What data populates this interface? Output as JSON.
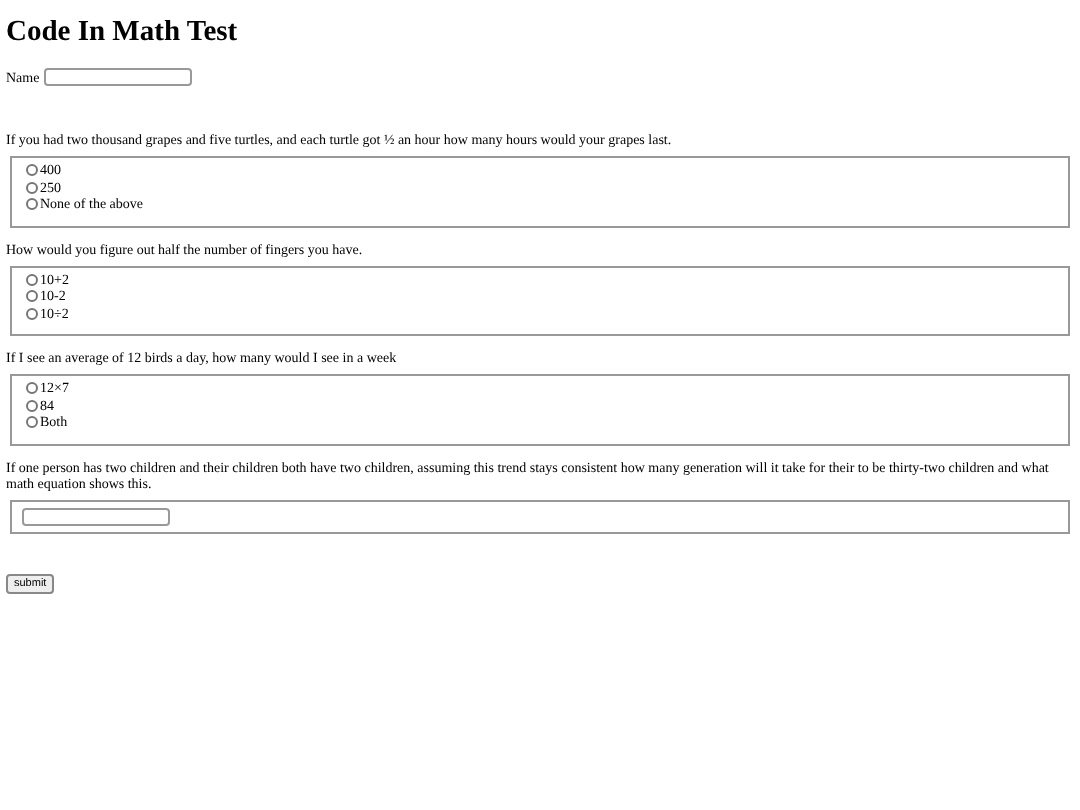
{
  "title": "Code In Math Test",
  "name_field": {
    "label": "Name"
  },
  "questions": [
    {
      "kind": "choice",
      "text": "If you had two thousand grapes and five turtles, and each turtle got ½ an hour how many hours would your grapes last.",
      "options": [
        {
          "label": "400",
          "selected": false
        },
        {
          "label": "250",
          "selected": false
        },
        {
          "label": "None of the above",
          "selected": false
        }
      ]
    },
    {
      "kind": "choice",
      "text": "How would you figure out half the number of fingers you have.",
      "options": [
        {
          "label": "10+2",
          "selected": false
        },
        {
          "label": "10-2",
          "selected": false
        },
        {
          "label": "10÷2",
          "selected": false
        }
      ]
    },
    {
      "kind": "choice",
      "text": "If I see an average of 12 birds a day, how many would I see in a week",
      "options": [
        {
          "label": "12×7",
          "selected": false
        },
        {
          "label": "84",
          "selected": false
        },
        {
          "label": "Both",
          "selected": false
        }
      ]
    },
    {
      "kind": "text",
      "text": "If one person has two children and their children both have two children, assuming this trend stays consistent how many generation will it take for their to be thirty-two children and what math equation shows this."
    }
  ],
  "submit": "submit"
}
